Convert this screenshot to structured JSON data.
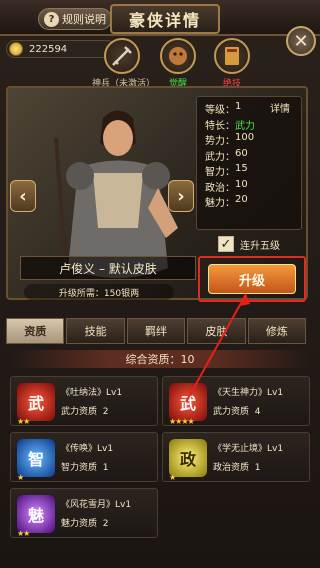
{
  "header": {
    "rules_label": "规则说明",
    "title": "豪侠详情",
    "close_icon": "close-icon"
  },
  "currency": {
    "amount": "222594"
  },
  "gear": [
    {
      "label": "神兵（未激活）",
      "color": "#d7c6a7"
    },
    {
      "label": "觉醒",
      "color": "#49e04a"
    },
    {
      "label": "绝技",
      "color": "#ff4040"
    }
  ],
  "hero": {
    "name": "卢俊义 – 默认皮肤",
    "cost_label": "升级所需：150银两"
  },
  "stats": {
    "detail_label": "详情",
    "rows": [
      {
        "label": "等级：",
        "value": "1"
      },
      {
        "label": "特长：",
        "value": "武力"
      },
      {
        "label": "势力：",
        "value": "100"
      },
      {
        "label": "武力：",
        "value": "60"
      },
      {
        "label": "智力：",
        "value": "15"
      },
      {
        "label": "政治：",
        "value": "10"
      },
      {
        "label": "魅力：",
        "value": "20"
      }
    ]
  },
  "upgrade": {
    "check_label": "连升五级",
    "button_label": "升级"
  },
  "tabs": [
    "资质",
    "技能",
    "羁绊",
    "皮肤",
    "修炼"
  ],
  "aptitude": {
    "total_label": "综合资质：10"
  },
  "skills": [
    {
      "name": "《吐纳法》Lv1",
      "stat": "武力资质",
      "value": "2",
      "icon_char": "武",
      "color": "#d4181b",
      "stars": "★★"
    },
    {
      "name": "《天生神力》Lv1",
      "stat": "武力资质",
      "value": "4",
      "icon_char": "武",
      "color": "#e01b15",
      "stars": "★★★★"
    },
    {
      "name": "《传唤》Lv1",
      "stat": "智力资质",
      "value": "1",
      "icon_char": "智",
      "color": "#1f70d8",
      "stars": "★"
    },
    {
      "name": "《学无止境》Lv1",
      "stat": "政治资质",
      "value": "1",
      "icon_char": "政",
      "color": "#e4d11a",
      "stars": "★"
    },
    {
      "name": "《风花雪月》Lv1",
      "stat": "魅力资质",
      "value": "2",
      "icon_char": "魅",
      "color": "#9a2ce0",
      "stars": "★★"
    }
  ]
}
